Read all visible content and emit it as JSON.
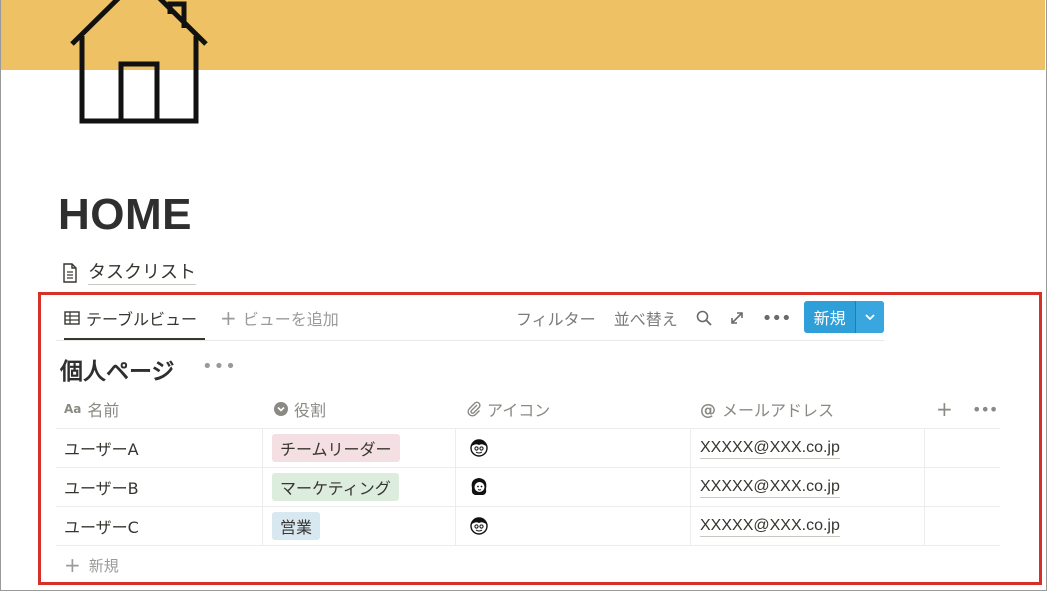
{
  "page": {
    "title": "HOME",
    "cover_color": "#eec165"
  },
  "link": {
    "label": "タスクリスト"
  },
  "view_bar": {
    "active_tab": "テーブルビュー",
    "add_view": "ビューを追加",
    "filter": "フィルター",
    "sort": "並べ替え",
    "new_button": "新規"
  },
  "database": {
    "title": "個人ページ",
    "columns": [
      {
        "label": "名前",
        "icon": "Aa"
      },
      {
        "label": "役割",
        "icon": "select-icon"
      },
      {
        "label": "アイコン",
        "icon": "paperclip-icon"
      },
      {
        "label": "メールアドレス",
        "icon": "@"
      }
    ],
    "rows": [
      {
        "name": "ユーザーA",
        "role": "チームリーダー",
        "role_color": "#f4dfe3",
        "avatar": "avatar-male",
        "email": "XXXXX@XXX.co.jp"
      },
      {
        "name": "ユーザーB",
        "role": "マーケティング",
        "role_color": "#dcecdd",
        "avatar": "avatar-female",
        "email": "XXXXX@XXX.co.jp"
      },
      {
        "name": "ユーザーC",
        "role": "営業",
        "role_color": "#d8e8f1",
        "avatar": "avatar-male",
        "email": "XXXXX@XXX.co.jp"
      }
    ],
    "add_row_label": "新規"
  },
  "accent_color": "#2f9fd9",
  "highlight_color": "#d63028"
}
